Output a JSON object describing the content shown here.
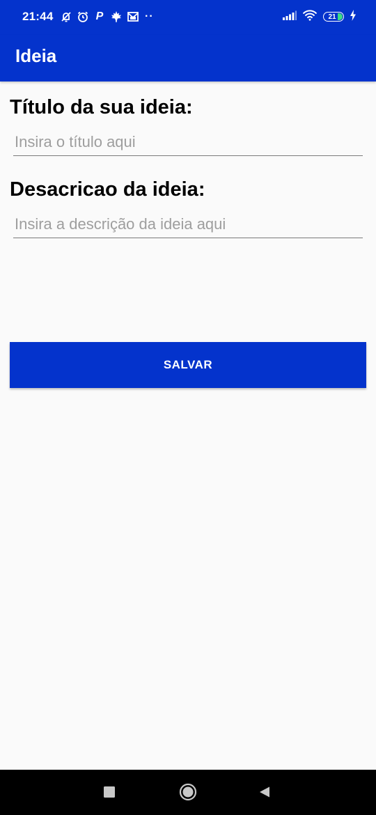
{
  "status_bar": {
    "time": "21:44",
    "battery_level": "21",
    "icons_left": [
      "alarm-off-icon",
      "alarm-clock-icon",
      "p-app-icon",
      "maple-leaf-icon",
      "mail-icon",
      "more-dots-icon"
    ],
    "icons_right": [
      "signal-icon",
      "wifi-icon",
      "battery-icon",
      "charging-icon"
    ],
    "p_letter": "P",
    "dots": "··"
  },
  "app_bar": {
    "title": "Ideia",
    "color": "#0433cc"
  },
  "form": {
    "title_label": "Título da sua ideia:",
    "title_value": "",
    "title_placeholder": "Insira o título aqui",
    "description_label": "Desacricao da ideia:",
    "description_value": "",
    "description_placeholder": "Insira a descrição da ideia aqui",
    "save_label": "SALVAR"
  },
  "nav_bar": {
    "buttons": [
      "recent-apps-icon",
      "home-icon",
      "back-icon"
    ]
  }
}
